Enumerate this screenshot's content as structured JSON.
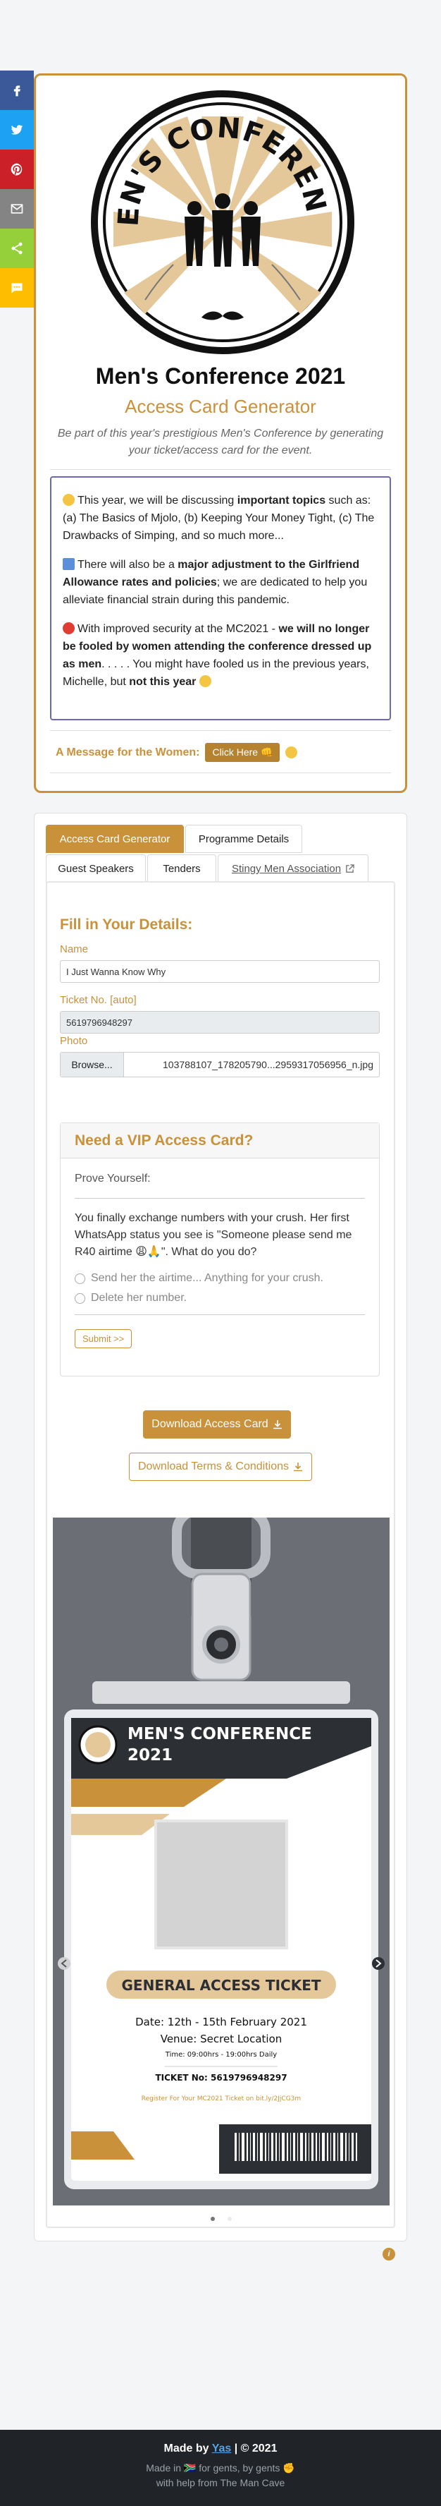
{
  "share": {
    "buttons": [
      {
        "name": "facebook",
        "color": "#3b5998",
        "glyph": "f"
      },
      {
        "name": "twitter",
        "color": "#1da1f2",
        "glyph": ""
      },
      {
        "name": "pinterest",
        "color": "#cb2027",
        "glyph": ""
      },
      {
        "name": "email",
        "color": "#848484",
        "glyph": ""
      },
      {
        "name": "share",
        "color": "#95d03a",
        "glyph": ""
      },
      {
        "name": "sms",
        "color": "#ffbd00",
        "glyph": ""
      }
    ]
  },
  "hero": {
    "logo_text": "MEN'S CONFERENCE",
    "title": "Men's Conference 2021",
    "subtitle": "Access Card Generator",
    "description": "Be part of this year's prestigious Men's Conference by generating your ticket/access card for the event."
  },
  "info": {
    "p1_a": "This year, we will be discussing ",
    "p1_b": "important topics",
    "p1_c": " such as: (a) The Basics of Mjolo, (b) Keeping Your Money Tight, (c) The Drawbacks of Simping, and so much more...",
    "p2_a": "There will also be a ",
    "p2_b": "major adjustment to the Girlfriend Allowance rates and policies",
    "p2_c": "; we are dedicated to help you alleviate financial strain during this pandemic.",
    "p3_a": "With improved security at the MC2021 - ",
    "p3_b": "we will no longer be fooled by women attending the conference dressed up as men",
    "p3_c": ". . . . . You might have fooled us in the previous years, Michelle, but ",
    "p3_d": "not this year"
  },
  "message": {
    "label": "A Message for the Women:",
    "button": "Click Here 👊"
  },
  "tabs": [
    {
      "label": "Access Card Generator"
    },
    {
      "label": "Programme Details"
    },
    {
      "label": "Guest Speakers"
    },
    {
      "label": "Tenders"
    },
    {
      "label": "Stingy Men Association"
    }
  ],
  "form": {
    "title": "Fill in Your Details:",
    "name_label": "Name",
    "name_value": "I Just Wanna Know Why",
    "ticket_label": "Ticket No. [auto]",
    "ticket_value": "5619796948297",
    "photo_label": "Photo",
    "browse": "Browse...",
    "file_name": "103788107_178205790...2959317056956_n.jpg"
  },
  "vip": {
    "heading": "Need a VIP Access Card?",
    "prove": "Prove Yourself:",
    "question": "You finally exchange numbers with your crush. Her first WhatsApp status you see is \"Someone please send me R40 airtime 😩🙏\". What do you do?",
    "options": [
      "Send her the airtime... Anything for your crush.",
      "Delete her number."
    ],
    "submit": "Submit >>"
  },
  "downloads": {
    "primary": "Download Access Card",
    "secondary": "Download Terms & Conditions"
  },
  "ticket": {
    "header": "MEN'S CONFERENCE 2021",
    "type": "GENERAL ACCESS TICKET",
    "date": "Date: 12th - 15th February 2021",
    "venue": "Venue: Secret Location",
    "time": "Time: 09:00hrs - 19:00hrs Daily",
    "ticket_no": "TICKET No: 5619796948297",
    "register": "Register For Your MC2021 Ticket on bit.ly/2JjCG3m"
  },
  "footer": {
    "made_by_prefix": "Made by ",
    "made_by_link": "Yas",
    "made_by_suffix": " | © 2021",
    "made_in": "Made in 🇿🇦 for gents, by gents ✊",
    "help": "with help from The Man Cave"
  },
  "colors": {
    "accent": "#c9913a",
    "dark": "#202429"
  }
}
